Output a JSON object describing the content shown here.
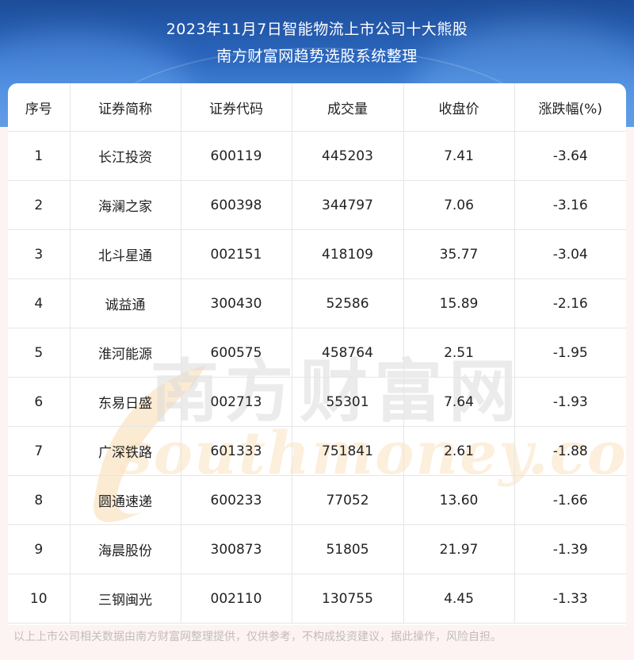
{
  "header": {
    "title_line1": "2023年11月7日智能物流上市公司十大熊股",
    "title_line2": "南方财富网趋势选股系统整理"
  },
  "table": {
    "columns": [
      "序号",
      "证券简称",
      "证券代码",
      "成交量",
      "收盘价",
      "涨跌幅(%)"
    ],
    "rows": [
      [
        "1",
        "长江投资",
        "600119",
        "445203",
        "7.41",
        "-3.64"
      ],
      [
        "2",
        "海澜之家",
        "600398",
        "344797",
        "7.06",
        "-3.16"
      ],
      [
        "3",
        "北斗星通",
        "002151",
        "418109",
        "35.77",
        "-3.04"
      ],
      [
        "4",
        "诚益通",
        "300430",
        "52586",
        "15.89",
        "-2.16"
      ],
      [
        "5",
        "淮河能源",
        "600575",
        "458764",
        "2.51",
        "-1.95"
      ],
      [
        "6",
        "东易日盛",
        "002713",
        "55301",
        "7.64",
        "-1.93"
      ],
      [
        "7",
        "广深铁路",
        "601333",
        "751841",
        "2.61",
        "-1.88"
      ],
      [
        "8",
        "圆通速递",
        "600233",
        "77052",
        "13.60",
        "-1.66"
      ],
      [
        "9",
        "海晨股份",
        "300873",
        "51805",
        "21.97",
        "-1.39"
      ],
      [
        "10",
        "三钢闽光",
        "002110",
        "130755",
        "4.45",
        "-1.33"
      ]
    ]
  },
  "watermark": {
    "cn": "南方财富网",
    "en": "southmoney.com"
  },
  "footer": {
    "disclaimer": "以上上市公司相关数据由南方财富网整理提供，仅供参考，不构成投资建议，据此操作，风险自担。"
  }
}
